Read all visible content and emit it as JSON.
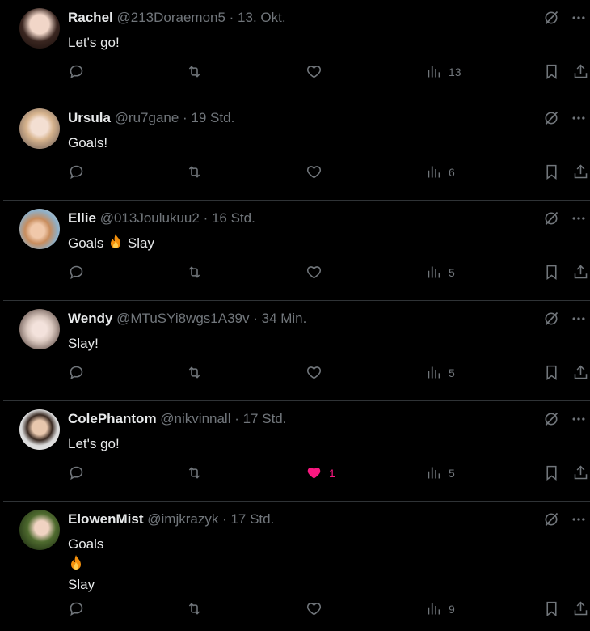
{
  "colors": {
    "background": "#000000",
    "text": "#e7e9ea",
    "muted": "#71767b",
    "divider": "#2f3336",
    "like": "#f91880"
  },
  "tweets": [
    {
      "name": "Rachel",
      "handle": "@213Doraemon5",
      "time": "13. Okt.",
      "lines": [
        "Let's go!"
      ],
      "likes": "",
      "views": "13"
    },
    {
      "name": "Ursula",
      "handle": "@ru7gane",
      "time": "19 Std.",
      "lines": [
        "Goals!"
      ],
      "likes": "",
      "views": "6"
    },
    {
      "name": "Ellie",
      "handle": "@013Joulukuu2",
      "time": "16 Std.",
      "lines": [
        "Goals",
        "Slay"
      ],
      "likes": "",
      "views": "5"
    },
    {
      "name": "Wendy",
      "handle": "@MTuSYi8wgs1A39v",
      "time": "34 Min.",
      "lines": [
        "Slay!"
      ],
      "likes": "",
      "views": "5"
    },
    {
      "name": "ColePhantom",
      "handle": "@nikvinnall",
      "time": "17 Std.",
      "lines": [
        "Let's go!"
      ],
      "likes": "1",
      "views": "5"
    },
    {
      "name": "ElowenMist",
      "handle": "@imjkrazyk",
      "time": "17 Std.",
      "lines": [
        "Goals",
        "Slay"
      ],
      "likes": "",
      "views": "9"
    }
  ],
  "separator": " · "
}
